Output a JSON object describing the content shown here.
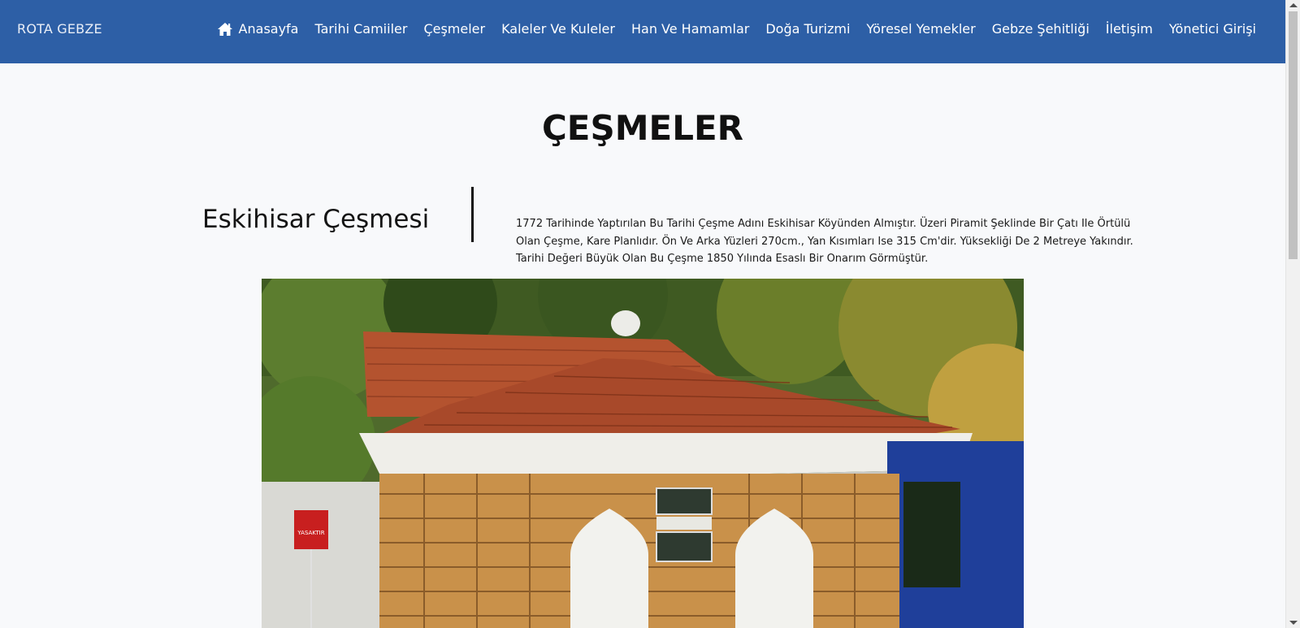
{
  "navbar": {
    "brand": "ROTA GEBZE",
    "links": [
      {
        "label": "Anasayfa",
        "icon": "home-icon"
      },
      {
        "label": "Tarihi Camiiler"
      },
      {
        "label": "Çeşmeler"
      },
      {
        "label": "Kaleler Ve Kuleler"
      },
      {
        "label": "Han Ve Hamamlar"
      },
      {
        "label": "Doğa Turizmi"
      },
      {
        "label": "Yöresel Yemekler"
      },
      {
        "label": "Gebze Şehitliği"
      },
      {
        "label": "İletişim"
      },
      {
        "label": "Yönetici Girişi"
      }
    ],
    "color": "#2d5fa6"
  },
  "page": {
    "title": "ÇEŞMELER"
  },
  "item": {
    "title": "Eskihisar Çeşmesi",
    "description": "1772 Tarihinde Yaptırılan Bu Tarihi Çeşme Adını Eskihisar Köyünden Almıştır. Üzeri Piramit Şeklinde Bir Çatı Ile Örtülü Olan Çeşme, Kare Planlıdır. Ön Ve Arka Yüzleri 270cm., Yan Kısımları Ise 315 Cm'dir. Yüksekliği De 2 Metreye Yakındır. Tarihi Değeri Büyük Olan Bu Çeşme 1850 Yılında Esaslı Bir Onarım Görmüştür.",
    "photo_sign_text": "YASAKTIR"
  }
}
